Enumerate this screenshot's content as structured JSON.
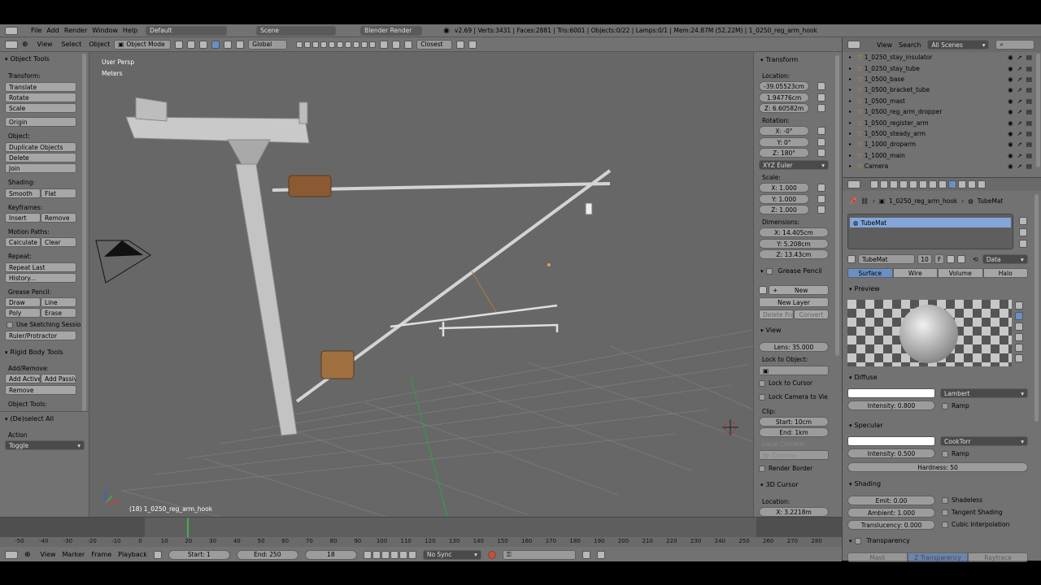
{
  "info_bar": {
    "menus": [
      "File",
      "Add",
      "Render",
      "Window",
      "Help"
    ],
    "layout": "Default",
    "scene": "Scene",
    "engine": "Blender Render",
    "stats": "v2.69 | Verts:3431 | Faces:2881 | Tris:6001 | Objects:0/22 | Lamps:0/1 | Mem:24.87M (52.22M) | 1_0250_reg_arm_hook"
  },
  "view3d_header": {
    "menus": [
      "View",
      "Select",
      "Object"
    ],
    "mode": "Object Mode",
    "orientation": "Global",
    "snap": "Closest"
  },
  "tools": {
    "title": "Object Tools",
    "transform_label": "Transform:",
    "translate": "Translate",
    "rotate": "Rotate",
    "scale": "Scale",
    "origin": "Origin",
    "object_label": "Object:",
    "duplicate": "Duplicate Objects",
    "delete": "Delete",
    "join": "Join",
    "shading_label": "Shading:",
    "smooth": "Smooth",
    "flat": "Flat",
    "keyframes_label": "Keyframes:",
    "insert": "Insert",
    "remove": "Remove",
    "motion_label": "Motion Paths:",
    "calculate": "Calculate",
    "clear": "Clear",
    "repeat_label": "Repeat:",
    "repeat_last": "Repeat Last",
    "history": "History...",
    "grease_label": "Grease Pencil:",
    "draw": "Draw",
    "line": "Line",
    "poly": "Poly",
    "erase": "Erase",
    "sketching": "Use Sketching Sessio",
    "ruler": "Ruler/Protractor",
    "rigid_title": "Rigid Body Tools",
    "addremove_label": "Add/Remove:",
    "add_active": "Add Active",
    "add_passive": "Add Passive",
    "rb_remove": "Remove",
    "object_tools_label": "Object Tools:",
    "deselect_title": "(De)select All",
    "action_label": "Action",
    "action_value": "Toggle"
  },
  "viewport": {
    "view_name": "User Persp",
    "units": "Meters",
    "object_label": "(18) 1_0250_reg_arm_hook"
  },
  "properties": {
    "transform_title": "Transform",
    "location_label": "Location:",
    "loc_x": "-39.05523cm",
    "loc_y": "1.94776cm",
    "loc_z": "Z: 6.60582m",
    "rotation_label": "Rotation:",
    "rot_x": "X: -0°",
    "rot_y": "Y: 0°",
    "rot_z": "Z: 180°",
    "euler": "XYZ Euler",
    "scale_label": "Scale:",
    "scale_x": "X: 1.000",
    "scale_y": "Y: 1.000",
    "scale_z": "Z: 1.000",
    "dimensions_label": "Dimensions:",
    "dim_x": "X: 14.405cm",
    "dim_y": "Y: 5.208cm",
    "dim_z": "Z: 13.43cm",
    "grease_title": "Grease Pencil",
    "new": "New",
    "new_layer": "New Layer",
    "delete_frame": "Delete Fram",
    "convert": "Convert",
    "view_title": "View",
    "lens": "Lens: 35.000",
    "lock_object": "Lock to Object:",
    "lock_cursor": "Lock to Cursor",
    "lock_camera": "Lock Camera to Vie",
    "clip_label": "Clip:",
    "clip_start": "Start: 10cm",
    "clip_end": "End: 1km",
    "local_camera": "Local Camera:",
    "camera": "Camera",
    "render_border": "Render Border",
    "cursor_title": "3D Cursor",
    "cursor_loc": "Location:",
    "cursor_x": "X: 3.2218m"
  },
  "outliner": {
    "menus": [
      "View",
      "Search"
    ],
    "filter": "All Scenes",
    "items": [
      "1_0250_stay_insulator",
      "1_0250_stay_tube",
      "1_0500_base",
      "1_0500_bracket_tube",
      "1_0500_mast",
      "1_0500_reg_arm_dropper",
      "1_0500_register_arm",
      "1_0500_steady_arm",
      "1_1000_droparm",
      "1_1000_main",
      "Camera"
    ]
  },
  "material": {
    "breadcrumb_object": "1_0250_reg_arm_hook",
    "breadcrumb_material": "TubeMat",
    "slot": "TubeMat",
    "name": "TubeMat",
    "users": "10",
    "fake": "F",
    "data": "Data",
    "tabs": [
      "Surface",
      "Wire",
      "Volume",
      "Halo"
    ],
    "preview_title": "Preview",
    "diffuse_title": "Diffuse",
    "diffuse_shader": "Lambert",
    "diffuse_intensity": "Intensity: 0.800",
    "ramp": "Ramp",
    "specular_title": "Specular",
    "specular_shader": "CookTorr",
    "specular_intensity": "Intensity: 0.500",
    "hardness": "Hardness: 50",
    "shading_title": "Shading",
    "emit": "Emit: 0.00",
    "ambient": "Ambient: 1.000",
    "translucency": "Translucency: 0.000",
    "shadeless": "Shadeless",
    "tangent": "Tangent Shading",
    "cubic": "Cubic Interpolation",
    "transparency_title": "Transparency",
    "trans_tabs": [
      "Mask",
      "Z Transparency",
      "Raytrace"
    ]
  },
  "timeline": {
    "ticks": [
      "-50",
      "-40",
      "-30",
      "-20",
      "-10",
      "0",
      "10",
      "20",
      "30",
      "40",
      "50",
      "60",
      "70",
      "80",
      "90",
      "100",
      "110",
      "120",
      "130",
      "140",
      "150",
      "160",
      "170",
      "180",
      "190",
      "200",
      "210",
      "220",
      "230",
      "240",
      "250",
      "260",
      "270",
      "280"
    ],
    "menus": [
      "View",
      "Marker",
      "Frame",
      "Playback"
    ],
    "start": "Start: 1",
    "end": "End: 250",
    "current": "18",
    "sync": "No Sync"
  }
}
